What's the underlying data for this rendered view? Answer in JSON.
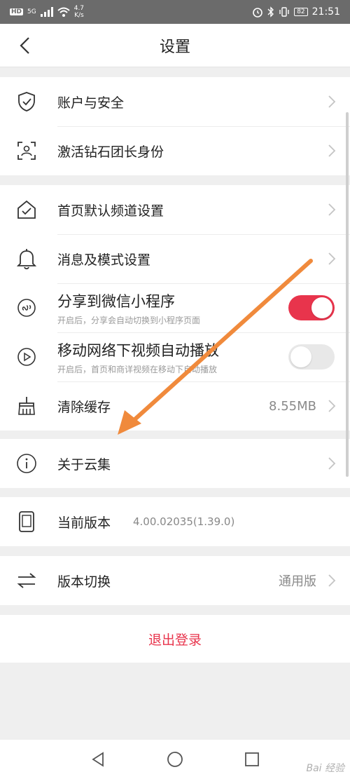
{
  "status_bar": {
    "hd": "HD",
    "network": "5G",
    "speed_value": "4.7",
    "speed_unit": "K/s",
    "battery": "82",
    "time": "21:51"
  },
  "header": {
    "title": "设置"
  },
  "groups": {
    "account": {
      "items": [
        {
          "label": "账户与安全",
          "icon": "shield-check-icon"
        },
        {
          "label": "激活钻石团长身份",
          "icon": "user-scan-icon"
        }
      ]
    },
    "settings": {
      "items": [
        {
          "label": "首页默认频道设置",
          "icon": "home-check-icon"
        },
        {
          "label": "消息及模式设置",
          "icon": "bell-icon"
        },
        {
          "label": "分享到微信小程序",
          "subtitle": "开启后，分享会自动切换到小程序页面",
          "icon": "miniprogram-icon",
          "toggle": true
        },
        {
          "label": "移动网络下视频自动播放",
          "subtitle": "开启后，首页和商详视频在移动下自动播放",
          "icon": "play-circle-icon",
          "toggle": false
        },
        {
          "label": "清除缓存",
          "value": "8.55MB",
          "icon": "broom-icon"
        }
      ]
    },
    "about": {
      "items": [
        {
          "label": "关于云集",
          "icon": "info-icon"
        }
      ]
    },
    "version": {
      "items": [
        {
          "label": "当前版本",
          "value": "4.00.02035(1.39.0)",
          "icon": "phone-icon"
        }
      ]
    },
    "switch": {
      "items": [
        {
          "label": "版本切换",
          "value": "通用版",
          "icon": "swap-arrows-icon"
        }
      ]
    }
  },
  "logout": {
    "label": "退出登录"
  },
  "watermark": "Bai 经验",
  "colors": {
    "accent": "#e8344c",
    "arrow": "#f08a3c"
  }
}
